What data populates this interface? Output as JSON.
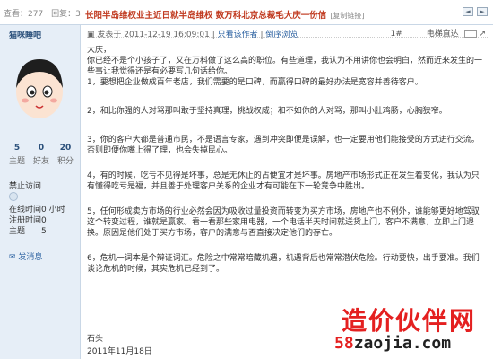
{
  "stats": {
    "views": "查看：277",
    "replies": "回复：3"
  },
  "thread_title": "长阳半岛维权业主近日就半岛维权 数万科北京总裁毛大庆一份信",
  "copy_link": "[复制链接]",
  "user": {
    "name": "猫咪睡吧",
    "counts": [
      {
        "num": "5",
        "label": "主题"
      },
      {
        "num": "0",
        "label": "好友"
      },
      {
        "num": "20",
        "label": "积分"
      }
    ],
    "rank": "禁止访问",
    "info": [
      {
        "k": "在线时间",
        "v": "0 小时"
      },
      {
        "k": "注册时间",
        "v": "0"
      },
      {
        "k": "主题",
        "v": "5"
      }
    ],
    "send_msg": "发消息"
  },
  "post": {
    "meta_prefix": "发表于 2011-12-19 16:09:01",
    "only_author": "只看该作者",
    "reverse": "倒序浏览",
    "floor": "1#",
    "elevator": "电梯直达",
    "paragraphs": [
      "大庆，",
      "你已经不是个小孩子了，又在万科做了这么高的职位。有些道理，我认为不用讲你也会明白，然而近来发生的一些事让我觉得还是有必要写几句话给你。",
      "1，要想把企业做成百年老店，我们需要的是口碑，而赢得口碑的最好办法是宽容并善待客户。",
      "2，和比你强的人对骂那叫敢于坚持真理，挑战权威；和不如你的人对骂，那叫小肚鸡肠，心胸狭窄。",
      "3，你的客户大都是普通市民，不是语言专家，遇到冲突即便是误解，也一定要用他们能接受的方式进行交流。否则即便你嘴上得了理，也会失掉民心。",
      "4，有的时候，吃亏不见得是坏事，总是无休止的占便宜才是坏事。房地产市场形式正在发生着变化，我认为只有懂得吃亏是福，并且善于处理客户关系的企业才有可能在下一轮竞争中胜出。",
      "5，任何形成卖方市场的行业必然会因为吸收过量投资而转变为买方市场，房地产也不例外，谁能够更好地驾驭这个转变过程，谁就是赢家。看一看那些家用电器，一个电话半天时间就送货上门，客户不满意，立即上门退换。原因是他们处于买方市场，客户的满意与否直接决定他们的存亡。",
      "6，危机一词本是个辩证词汇。危险之中常常暗藏机遇，机遇背后也常常潜伏危险。行动要快，出手要准。我们谈论危机的时候，其实危机已经到了。"
    ],
    "signature": "石头",
    "date": "2011年11月18日"
  },
  "watermark": {
    "line1": "造价伙伴网",
    "line2_num": "58",
    "line2_rest": "zaojia.com"
  }
}
